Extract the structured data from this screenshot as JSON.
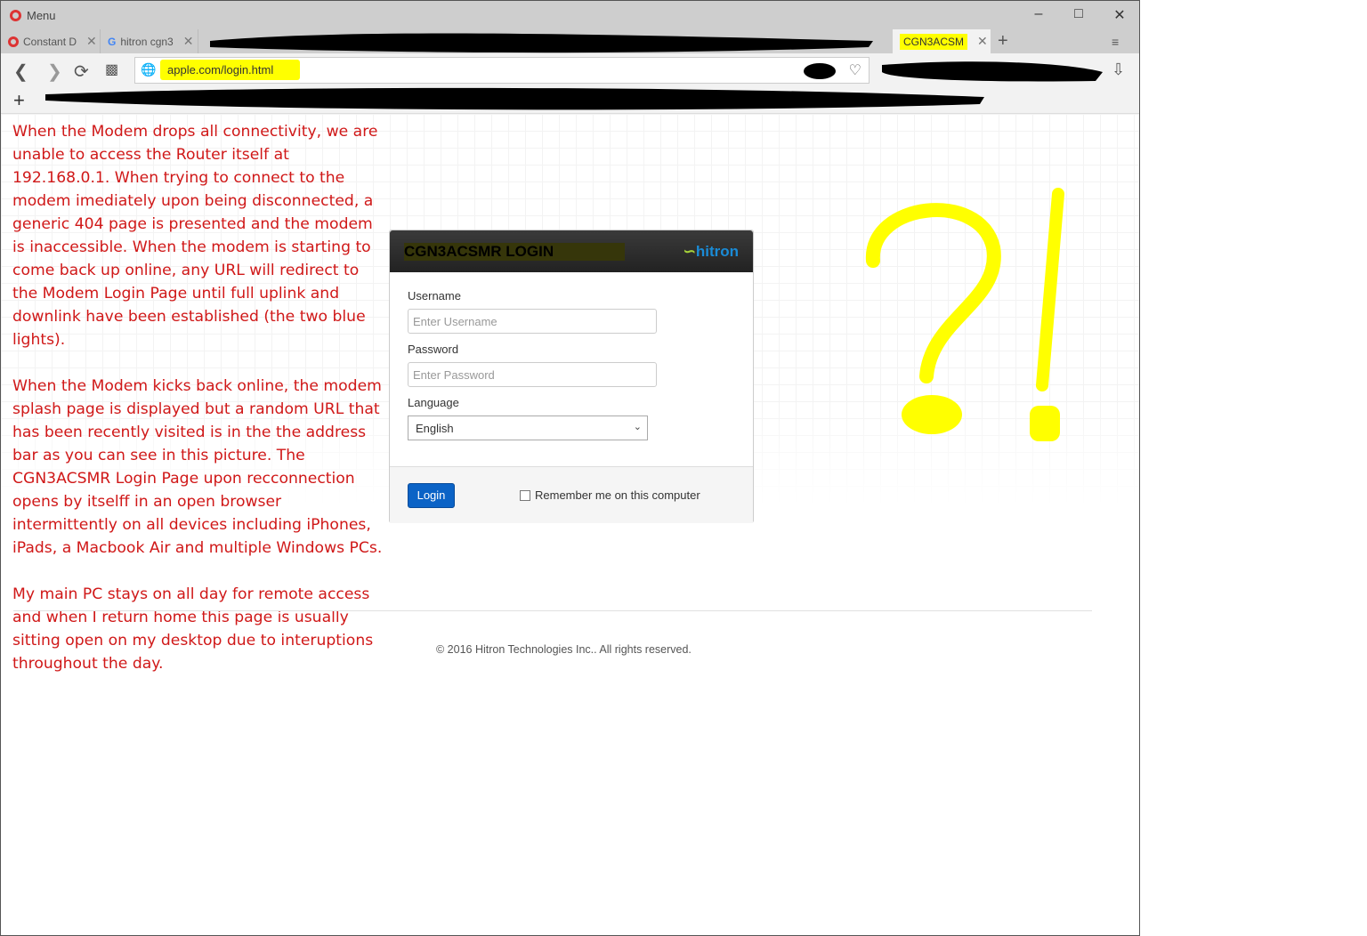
{
  "browser": {
    "menu_label": "Menu",
    "tabs": [
      {
        "label": "Constant D"
      },
      {
        "label": "hitron cgn3"
      },
      {
        "label": "CGN3ACSM"
      }
    ],
    "url": "apple.com/login.html"
  },
  "login": {
    "title": "CGN3ACSMR LOGIN",
    "logo": "hitron",
    "username_label": "Username",
    "username_placeholder": "Enter Username",
    "password_label": "Password",
    "password_placeholder": "Enter Password",
    "language_label": "Language",
    "language_value": "English",
    "login_button": "Login",
    "remember_label": "Remember me on this computer"
  },
  "footer": {
    "copyright": "© 2016 Hitron Technologies Inc.. All rights reserved."
  },
  "annotation": {
    "paragraphs": [
      "When the Modem drops all connectivity, we are unable to access the Router itself at 192.168.0.1. When trying to connect to the modem imediately upon being disconnected, a generic 404 page is presented and the modem is inaccessible. When the modem is starting to come back up online, any URL will redirect to the Modem Login Page until full uplink and downlink have been established (the two blue lights).",
      "When the Modem kicks back online, the modem splash page is displayed but a random URL that has been recently visited is in the the address bar as you can see in this picture. The CGN3ACSMR Login Page upon recconnection opens by itselff in an open browser intermittently on all devices including iPhones, iPads, a Macbook Air and multiple Windows PCs.",
      "My main PC stays on all day for remote access and when I return home this page is usually sitting open on my desktop due to interuptions throughout the day."
    ],
    "scribble": "?!",
    "highlight_color": "#ffff00",
    "text_color": "#d01818"
  }
}
